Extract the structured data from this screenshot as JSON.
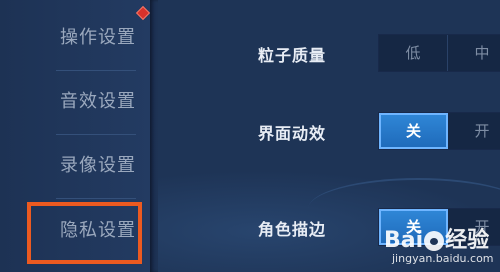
{
  "sidebar": {
    "items": [
      {
        "label": "操作设置"
      },
      {
        "label": "音效设置"
      },
      {
        "label": "录像设置"
      },
      {
        "label": "隐私设置"
      }
    ]
  },
  "settings": {
    "particle_quality": {
      "label": "粒子质量",
      "options": [
        "低",
        "中"
      ],
      "selected": null
    },
    "ui_animation": {
      "label": "界面动效",
      "options": [
        "关",
        "开"
      ],
      "selected": "关"
    },
    "character_outline": {
      "label": "角色描边",
      "options": [
        "关",
        "开"
      ],
      "selected": "关"
    }
  },
  "watermark": {
    "logo_left": "Bai",
    "logo_right": "经验",
    "url": "jingyan.baidu.com"
  },
  "colors": {
    "background": "#1f3557",
    "active_option": "#2f86d6",
    "highlight_box": "#ec5a20",
    "notification_badge": "#d9322b"
  }
}
